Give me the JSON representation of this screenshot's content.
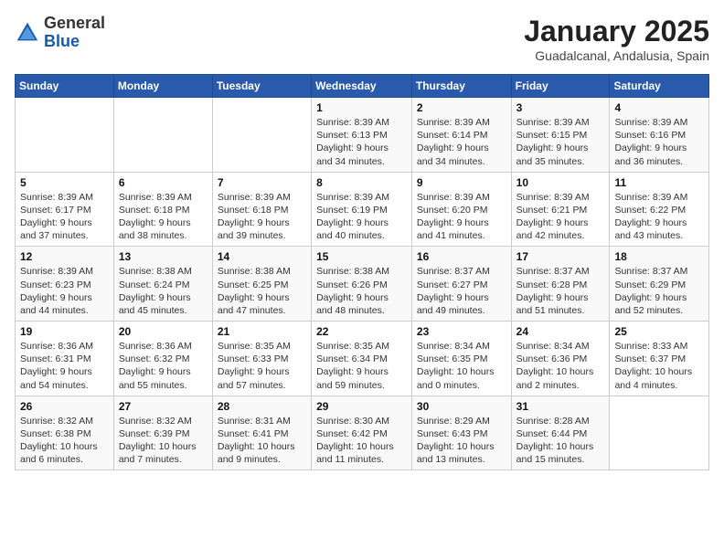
{
  "header": {
    "logo_general": "General",
    "logo_blue": "Blue",
    "month_title": "January 2025",
    "location": "Guadalcanal, Andalusia, Spain"
  },
  "days_of_week": [
    "Sunday",
    "Monday",
    "Tuesday",
    "Wednesday",
    "Thursday",
    "Friday",
    "Saturday"
  ],
  "weeks": [
    [
      {
        "day": "",
        "info": ""
      },
      {
        "day": "",
        "info": ""
      },
      {
        "day": "",
        "info": ""
      },
      {
        "day": "1",
        "info": "Sunrise: 8:39 AM\nSunset: 6:13 PM\nDaylight: 9 hours\nand 34 minutes."
      },
      {
        "day": "2",
        "info": "Sunrise: 8:39 AM\nSunset: 6:14 PM\nDaylight: 9 hours\nand 34 minutes."
      },
      {
        "day": "3",
        "info": "Sunrise: 8:39 AM\nSunset: 6:15 PM\nDaylight: 9 hours\nand 35 minutes."
      },
      {
        "day": "4",
        "info": "Sunrise: 8:39 AM\nSunset: 6:16 PM\nDaylight: 9 hours\nand 36 minutes."
      }
    ],
    [
      {
        "day": "5",
        "info": "Sunrise: 8:39 AM\nSunset: 6:17 PM\nDaylight: 9 hours\nand 37 minutes."
      },
      {
        "day": "6",
        "info": "Sunrise: 8:39 AM\nSunset: 6:18 PM\nDaylight: 9 hours\nand 38 minutes."
      },
      {
        "day": "7",
        "info": "Sunrise: 8:39 AM\nSunset: 6:18 PM\nDaylight: 9 hours\nand 39 minutes."
      },
      {
        "day": "8",
        "info": "Sunrise: 8:39 AM\nSunset: 6:19 PM\nDaylight: 9 hours\nand 40 minutes."
      },
      {
        "day": "9",
        "info": "Sunrise: 8:39 AM\nSunset: 6:20 PM\nDaylight: 9 hours\nand 41 minutes."
      },
      {
        "day": "10",
        "info": "Sunrise: 8:39 AM\nSunset: 6:21 PM\nDaylight: 9 hours\nand 42 minutes."
      },
      {
        "day": "11",
        "info": "Sunrise: 8:39 AM\nSunset: 6:22 PM\nDaylight: 9 hours\nand 43 minutes."
      }
    ],
    [
      {
        "day": "12",
        "info": "Sunrise: 8:39 AM\nSunset: 6:23 PM\nDaylight: 9 hours\nand 44 minutes."
      },
      {
        "day": "13",
        "info": "Sunrise: 8:38 AM\nSunset: 6:24 PM\nDaylight: 9 hours\nand 45 minutes."
      },
      {
        "day": "14",
        "info": "Sunrise: 8:38 AM\nSunset: 6:25 PM\nDaylight: 9 hours\nand 47 minutes."
      },
      {
        "day": "15",
        "info": "Sunrise: 8:38 AM\nSunset: 6:26 PM\nDaylight: 9 hours\nand 48 minutes."
      },
      {
        "day": "16",
        "info": "Sunrise: 8:37 AM\nSunset: 6:27 PM\nDaylight: 9 hours\nand 49 minutes."
      },
      {
        "day": "17",
        "info": "Sunrise: 8:37 AM\nSunset: 6:28 PM\nDaylight: 9 hours\nand 51 minutes."
      },
      {
        "day": "18",
        "info": "Sunrise: 8:37 AM\nSunset: 6:29 PM\nDaylight: 9 hours\nand 52 minutes."
      }
    ],
    [
      {
        "day": "19",
        "info": "Sunrise: 8:36 AM\nSunset: 6:31 PM\nDaylight: 9 hours\nand 54 minutes."
      },
      {
        "day": "20",
        "info": "Sunrise: 8:36 AM\nSunset: 6:32 PM\nDaylight: 9 hours\nand 55 minutes."
      },
      {
        "day": "21",
        "info": "Sunrise: 8:35 AM\nSunset: 6:33 PM\nDaylight: 9 hours\nand 57 minutes."
      },
      {
        "day": "22",
        "info": "Sunrise: 8:35 AM\nSunset: 6:34 PM\nDaylight: 9 hours\nand 59 minutes."
      },
      {
        "day": "23",
        "info": "Sunrise: 8:34 AM\nSunset: 6:35 PM\nDaylight: 10 hours\nand 0 minutes."
      },
      {
        "day": "24",
        "info": "Sunrise: 8:34 AM\nSunset: 6:36 PM\nDaylight: 10 hours\nand 2 minutes."
      },
      {
        "day": "25",
        "info": "Sunrise: 8:33 AM\nSunset: 6:37 PM\nDaylight: 10 hours\nand 4 minutes."
      }
    ],
    [
      {
        "day": "26",
        "info": "Sunrise: 8:32 AM\nSunset: 6:38 PM\nDaylight: 10 hours\nand 6 minutes."
      },
      {
        "day": "27",
        "info": "Sunrise: 8:32 AM\nSunset: 6:39 PM\nDaylight: 10 hours\nand 7 minutes."
      },
      {
        "day": "28",
        "info": "Sunrise: 8:31 AM\nSunset: 6:41 PM\nDaylight: 10 hours\nand 9 minutes."
      },
      {
        "day": "29",
        "info": "Sunrise: 8:30 AM\nSunset: 6:42 PM\nDaylight: 10 hours\nand 11 minutes."
      },
      {
        "day": "30",
        "info": "Sunrise: 8:29 AM\nSunset: 6:43 PM\nDaylight: 10 hours\nand 13 minutes."
      },
      {
        "day": "31",
        "info": "Sunrise: 8:28 AM\nSunset: 6:44 PM\nDaylight: 10 hours\nand 15 minutes."
      },
      {
        "day": "",
        "info": ""
      }
    ]
  ]
}
